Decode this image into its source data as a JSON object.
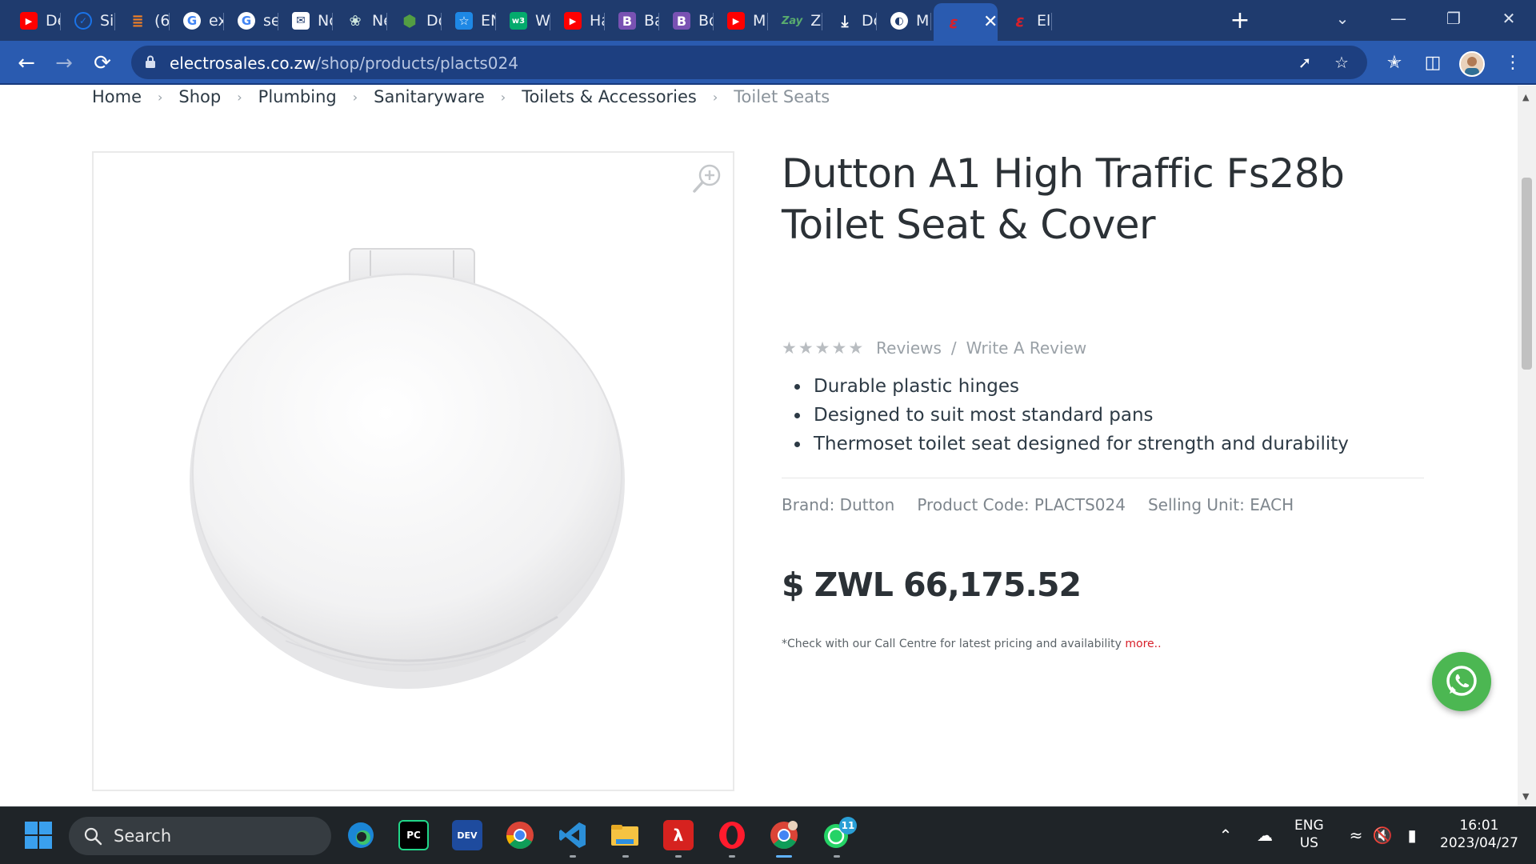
{
  "browser": {
    "tabs": [
      {
        "label": "De",
        "icon": "youtube-icon",
        "color": "#ff0000"
      },
      {
        "label": "Sig",
        "icon": "shield-icon",
        "color": "#1a73e8"
      },
      {
        "label": "(6)",
        "icon": "stackoverflow-icon",
        "color": "#f48024"
      },
      {
        "label": "ex",
        "icon": "google-icon",
        "color": "#ffffff"
      },
      {
        "label": "sei",
        "icon": "google-icon",
        "color": "#ffffff"
      },
      {
        "label": "Nc",
        "icon": "mail-icon",
        "color": "#ffffff"
      },
      {
        "label": "Ne",
        "icon": "openai-icon",
        "color": "#10a37f"
      },
      {
        "label": "Do",
        "icon": "nodejs-icon",
        "color": "#539e43"
      },
      {
        "label": "EN",
        "icon": "star-icon",
        "color": "#1e88e5"
      },
      {
        "label": "W",
        "icon": "w3schools-icon",
        "color": "#04aa6d"
      },
      {
        "label": "Ha",
        "icon": "youtube-icon",
        "color": "#ff0000"
      },
      {
        "label": "Ba",
        "icon": "bootstrap-icon",
        "color": "#7952b3"
      },
      {
        "label": "Bo",
        "icon": "bootstrap-icon",
        "color": "#7952b3"
      },
      {
        "label": "M",
        "icon": "youtube-icon",
        "color": "#ff0000"
      },
      {
        "label": "Za",
        "icon": "zay-icon",
        "color": "#59ab6e"
      },
      {
        "label": "Dc",
        "icon": "download-icon",
        "color": "#ffffff"
      },
      {
        "label": "M",
        "icon": "globe-icon",
        "color": "#ffffff"
      },
      {
        "label": "",
        "icon": "electrosales-icon",
        "color": "#d8202a",
        "active": true
      },
      {
        "label": "Ele",
        "icon": "electrosales-icon",
        "color": "#d8202a"
      }
    ],
    "zay_text": "Zay",
    "url_host": "electrosales.co.zw",
    "url_path": "/shop/products/placts024"
  },
  "breadcrumb": [
    "Home",
    "Shop",
    "Plumbing",
    "Sanitaryware",
    "Toilets & Accessories",
    "Toilet Seats"
  ],
  "product": {
    "title": "Dutton A1 High Traffic Fs28b Toilet Seat & Cover",
    "rating": 0,
    "reviews_link": "Reviews",
    "write_review_link": "Write A Review",
    "features": [
      "Durable plastic hinges",
      "Designed to suit most standard pans",
      "Thermoset toilet seat designed for strength and durability"
    ],
    "brand": "Brand: Dutton",
    "product_code": "Product Code: PLACTS024",
    "selling_unit": "Selling Unit: EACH",
    "price": "$ ZWL 66,175.52",
    "disclaimer": "*Check with our Call Centre for latest pricing and availability",
    "more_link": "more.."
  },
  "taskbar": {
    "search_label": "Search",
    "apps": [
      "edge-icon",
      "pycharm-icon",
      "devcpp-icon",
      "chrome-icon",
      "vscode-icon",
      "file-explorer-icon",
      "acrobat-icon",
      "opera-icon",
      "chrome-profile-icon",
      "whatsapp-icon"
    ],
    "pycharm_text": "PC",
    "devcpp_text": "DEV",
    "whatsapp_badge": "11",
    "lang_top": "ENG",
    "lang_bottom": "US",
    "time": "16:01",
    "date": "2023/04/27"
  },
  "colors": {
    "tabstrip": "#1f3b6e",
    "toolbar": "#2a5bb0",
    "accent_red": "#d8202a",
    "whatsapp_green": "#4cb752"
  }
}
